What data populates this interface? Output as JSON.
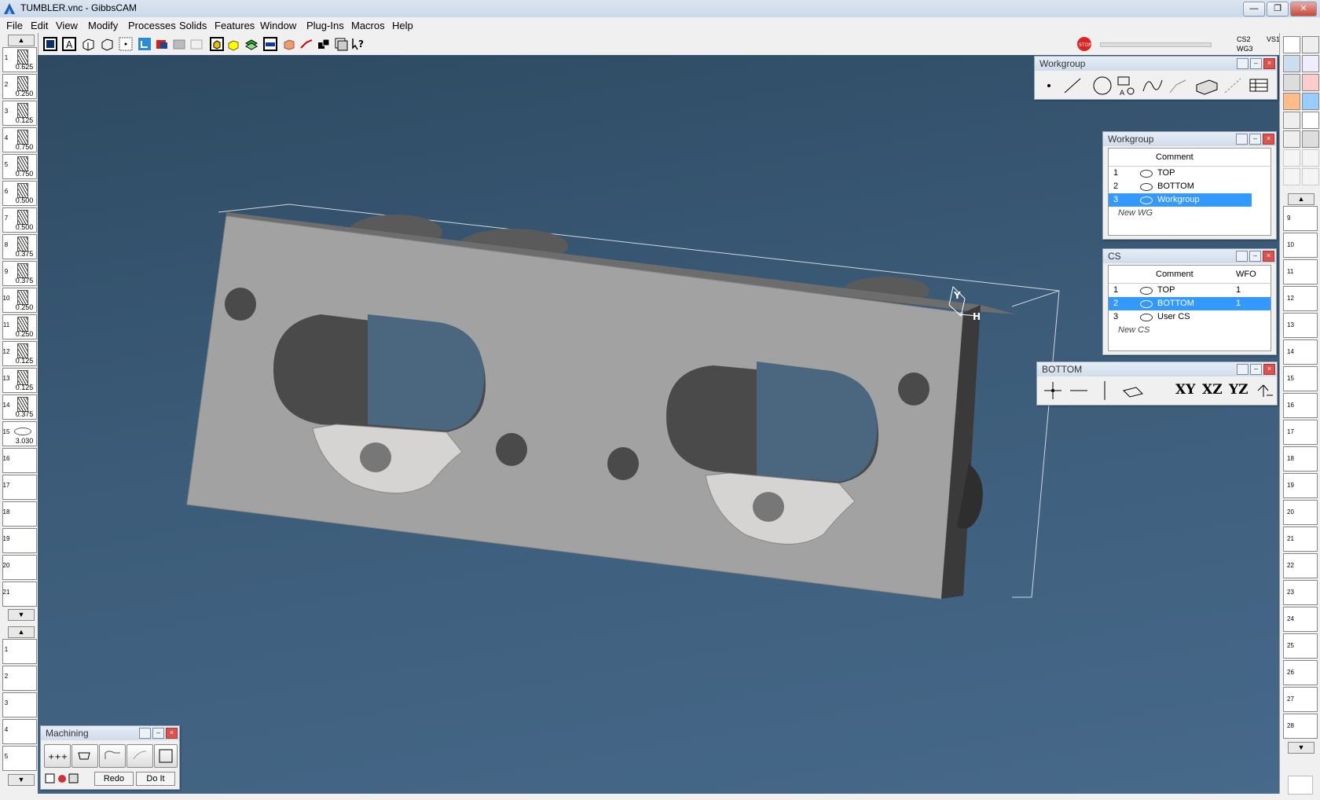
{
  "window": {
    "title": "TUMBLER.vnc - GibbsCAM",
    "min": "—",
    "max": "❐",
    "close": "✕"
  },
  "menu": [
    "File",
    "Edit",
    "View",
    "Modify",
    "Processes",
    "Solids",
    "Features",
    "Window",
    "Plug-Ins",
    "Macros",
    "Help"
  ],
  "status": {
    "cs": "CS2",
    "vs": "VS1",
    "wg": "WG3"
  },
  "tools": [
    {
      "n": "1",
      "d": "0.625"
    },
    {
      "n": "2",
      "d": "0.250"
    },
    {
      "n": "3",
      "d": "0.125"
    },
    {
      "n": "4",
      "d": "0.750"
    },
    {
      "n": "5",
      "d": "0.750"
    },
    {
      "n": "6",
      "d": "0.500"
    },
    {
      "n": "7",
      "d": "0.500"
    },
    {
      "n": "8",
      "d": "0.375"
    },
    {
      "n": "9",
      "d": "0.375"
    },
    {
      "n": "10",
      "d": "0.250"
    },
    {
      "n": "11",
      "d": "0.250"
    },
    {
      "n": "12",
      "d": "0.125"
    },
    {
      "n": "13",
      "d": "0.125"
    },
    {
      "n": "14",
      "d": "0.375"
    },
    {
      "n": "15",
      "d": "3.030"
    },
    {
      "n": "16",
      "d": ""
    },
    {
      "n": "17",
      "d": ""
    },
    {
      "n": "18",
      "d": ""
    },
    {
      "n": "19",
      "d": ""
    },
    {
      "n": "20",
      "d": ""
    },
    {
      "n": "21",
      "d": ""
    }
  ],
  "process_slots": [
    "1",
    "2",
    "3",
    "4",
    "5"
  ],
  "right_slots": [
    "9",
    "10",
    "11",
    "12",
    "13",
    "14",
    "15",
    "16",
    "17",
    "18",
    "19",
    "20",
    "21",
    "22",
    "23",
    "24",
    "25",
    "26",
    "27",
    "28"
  ],
  "geometry_palette": {
    "title": "Workgroup"
  },
  "workgroup_list": {
    "title": "Workgroup",
    "col_comment": "Comment",
    "rows": [
      {
        "n": "1",
        "c": "TOP"
      },
      {
        "n": "2",
        "c": "BOTTOM"
      },
      {
        "n": "3",
        "c": "Workgroup"
      }
    ],
    "new": "New WG"
  },
  "cs_list": {
    "title": "CS",
    "col_comment": "Comment",
    "col_wfo": "WFO",
    "rows": [
      {
        "n": "1",
        "c": "TOP",
        "w": "1"
      },
      {
        "n": "2",
        "c": "BOTTOM",
        "w": "1"
      },
      {
        "n": "3",
        "c": "User CS",
        "w": ""
      }
    ],
    "new": "New CS"
  },
  "cs_palette": {
    "title": "BOTTOM",
    "xy": "XY",
    "xz": "XZ",
    "yz": "YZ"
  },
  "machining": {
    "title": "Machining",
    "redo": "Redo",
    "doit": "Do It"
  },
  "axis": {
    "y": "Y",
    "h": "H"
  },
  "colors": {
    "viewport": "#3b5b78",
    "selection": "#3399ff",
    "part": "#a0a0a0"
  }
}
